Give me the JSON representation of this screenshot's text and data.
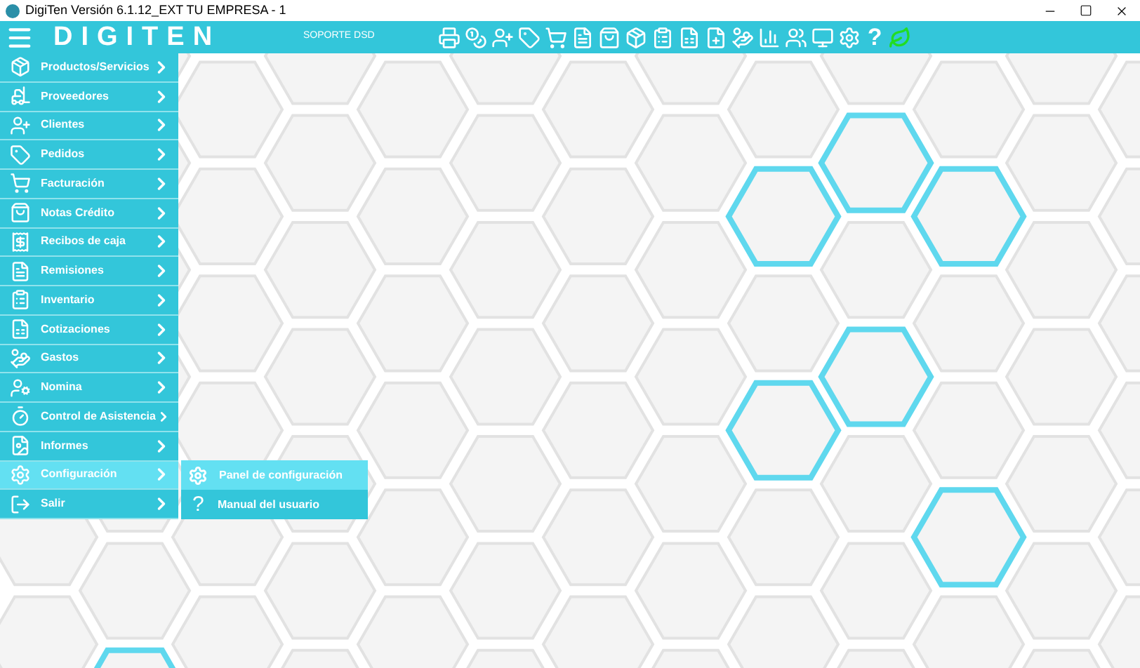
{
  "window": {
    "title": "DigiTen Versión 6.1.12_EXT TU EMPRESA - 1"
  },
  "toolbar": {
    "logo": "DIGITEN",
    "support_link": "SOPORTE DSD",
    "help_glyph": "?"
  },
  "sidebar": {
    "items": [
      {
        "label": "Productos/Servicios",
        "selected": false
      },
      {
        "label": "Proveedores",
        "selected": false
      },
      {
        "label": "Clientes",
        "selected": false
      },
      {
        "label": "Pedidos",
        "selected": false
      },
      {
        "label": "Facturación",
        "selected": false
      },
      {
        "label": "Notas Crédito",
        "selected": false
      },
      {
        "label": "Recibos de caja",
        "selected": false
      },
      {
        "label": "Remisiones",
        "selected": false
      },
      {
        "label": "Inventario",
        "selected": false
      },
      {
        "label": "Cotizaciones",
        "selected": false
      },
      {
        "label": "Gastos",
        "selected": false
      },
      {
        "label": "Nomina",
        "selected": false
      },
      {
        "label": "Control de Asistencia",
        "selected": false
      },
      {
        "label": "Informes",
        "selected": false
      },
      {
        "label": "Configuración",
        "selected": true
      },
      {
        "label": "Salir",
        "selected": false
      }
    ]
  },
  "submenu": {
    "items": [
      {
        "kind": "gear",
        "label": "Panel de configuración",
        "selected": true
      },
      {
        "kind": "glyph",
        "glyph": "?",
        "label": "Manual del usuario",
        "selected": false
      }
    ]
  }
}
